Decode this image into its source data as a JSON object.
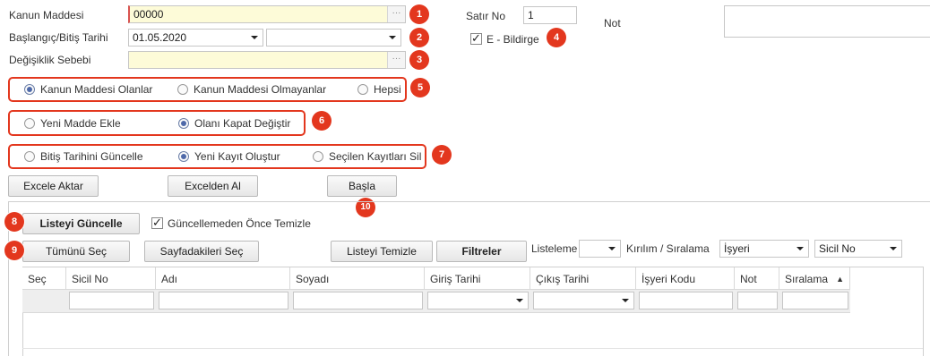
{
  "form": {
    "kanun_maddesi_label": "Kanun Maddesi",
    "kanun_maddesi_value": "00000",
    "tarih_label": "Başlangıç/Bitiş Tarihi",
    "baslangic_value": "01.05.2020",
    "bitis_value": "",
    "degisiklik_label": "Değişiklik Sebebi",
    "degisiklik_value": "",
    "ellipsis": "···",
    "satir_no_label": "Satır No",
    "satir_no_value": "1",
    "e_bildirge_label": "E - Bildirge",
    "e_bildirge_checked": true,
    "not_label": "Not",
    "not_value": ""
  },
  "badges": [
    "1",
    "2",
    "3",
    "4",
    "5",
    "6",
    "7",
    "8",
    "9",
    "10"
  ],
  "group_filter": {
    "options": [
      "Kanun Maddesi Olanlar",
      "Kanun Maddesi Olmayanlar",
      "Hepsi"
    ],
    "selected": 0
  },
  "group_action": {
    "options": [
      "Yeni Madde Ekle",
      "Olanı Kapat Değiştir"
    ],
    "selected": 1
  },
  "group_update": {
    "options": [
      "Bitiş Tarihini Güncelle",
      "Yeni Kayıt Oluştur",
      "Seçilen Kayıtları Sil"
    ],
    "selected": 1
  },
  "buttons": {
    "excele_aktar": "Excele Aktar",
    "excelden_al": "Excelden Al",
    "basla": "Başla",
    "listeyi_guncelle": "Listeyi Güncelle",
    "tumunu_sec": "Tümünü Seç",
    "sayfadakileri_sec": "Sayfadakileri Seç",
    "listeyi_temizle": "Listeyi Temizle",
    "filtreler": "Filtreler"
  },
  "guncellemeden_once": {
    "label": "Güncellemeden Önce Temizle",
    "checked": true
  },
  "listing": {
    "listeleme_label": "Listeleme",
    "listeleme_value": "",
    "kirilim_label": "Kırılım / Sıralama",
    "kirilim_value": "İşyeri",
    "siralama_value": "Sicil No"
  },
  "table": {
    "columns": [
      "Seç",
      "Sicil No",
      "Adı",
      "Soyadı",
      "Giriş Tarihi",
      "Çıkış Tarihi",
      "İşyeri Kodu",
      "Not",
      "Sıralama"
    ],
    "sort_indicator": "▲"
  },
  "colors": {
    "badge": "#e3371e",
    "highlight_border": "#e3371e",
    "input_yellow": "#fdfbd8",
    "radio_selected": "#4e69a9"
  }
}
